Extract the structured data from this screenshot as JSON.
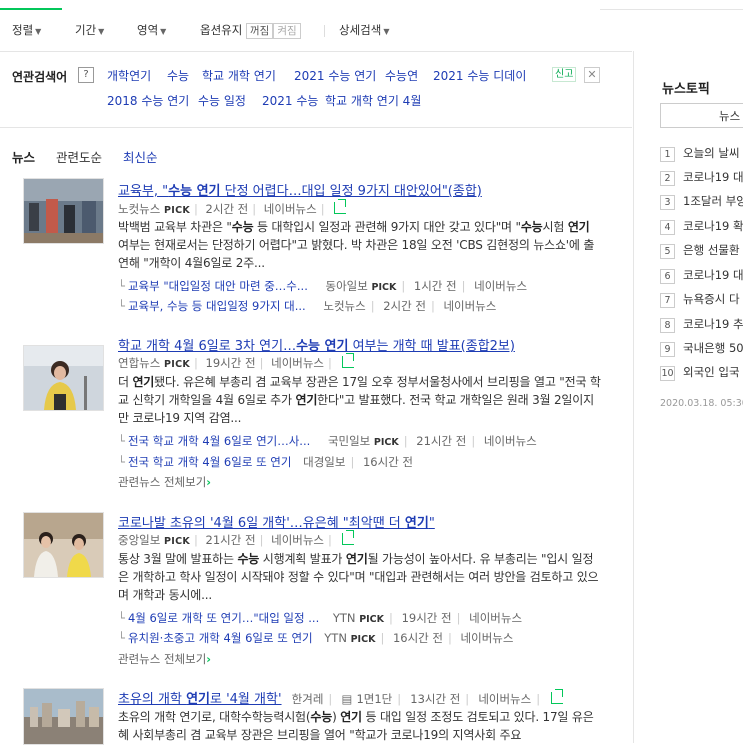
{
  "options": {
    "sort": "정렬",
    "period": "기간",
    "area": "영역",
    "option_keep": "옵션유지",
    "off": "꺼짐",
    "on": "켜짐",
    "detail_search": "상세검색"
  },
  "related": {
    "label": "연관검색어",
    "help": "?",
    "keywords": [
      "개학연기",
      "수능",
      "학교 개학 연기",
      "2021 수능 연기",
      "수능연",
      "2021 수능 디데이",
      "2018 수능 연기",
      "수능 일정",
      "2021 수능",
      "학교 개학 연기 4월"
    ],
    "report": "신고",
    "close": "✕"
  },
  "tabs": [
    "뉴스",
    "관련도순",
    "최신순"
  ],
  "articles": [
    {
      "title_pre": "교육부, \"",
      "title_bold": "수능 연기",
      "title_post": " 단정 어렵다…대입 일정 9가지 대안있어\"(종합)",
      "source": "노컷뉴스",
      "pick": "PICK",
      "time": "2시간 전",
      "portal": "네이버뉴스",
      "desc": [
        {
          "t": "박백범 교육부 차관은 \""
        },
        {
          "b": "수능"
        },
        {
          "t": " 등 대학입시 일정과 관련해 9가지 대안 갖고 있다\"며 \""
        },
        {
          "b": "수능"
        },
        {
          "t": "시험 "
        },
        {
          "b": "연기"
        },
        {
          "t": " 여부는 현재로서는 단정하기 어렵다\"고 밝혔다. 박 차관은 18일 오전 'CBS 김현정의 뉴스쇼'에 출연해 \"개학이 4월6일로 2주..."
        }
      ],
      "subs": [
        {
          "title": "교육부 \"대입일정 대안 마련 중…수...",
          "source": "동아일보",
          "pick": "PICK",
          "time": "1시간 전",
          "portal": "네이버뉴스"
        },
        {
          "title": "교육부, 수능 등 대입일정 9가지 대...",
          "source": "노컷뉴스",
          "pick": "",
          "time": "2시간 전",
          "portal": "네이버뉴스"
        }
      ]
    },
    {
      "title_pre": "학교 개학 4월 6일로 3차 연기…",
      "title_bold": "수능 연기",
      "title_post": " 여부는 개학 때 발표(종합2보)",
      "source": "연합뉴스",
      "pick": "PICK",
      "time": "19시간 전",
      "portal": "네이버뉴스",
      "desc": [
        {
          "t": "더 "
        },
        {
          "b": "연기"
        },
        {
          "t": "됐다. 유은혜 부총리 겸 교육부 장관은 17일 오후 정부서울청사에서 브리핑을 열고 \"전국 학교 신학기 개학일을 4월 6일로 추가 "
        },
        {
          "b": "연기"
        },
        {
          "t": "한다\"고 발표했다. 전국 학교 개학일은 원래 3월 2일이지만 코로나19 지역 감염..."
        }
      ],
      "subs": [
        {
          "title": "전국 학교 개학 4월 6일로 연기…사...",
          "source": "국민일보",
          "pick": "PICK",
          "time": "21시간 전",
          "portal": "네이버뉴스"
        },
        {
          "title": "전국 학교 개학 4월 6일로 또 연기",
          "source": "대경일보",
          "pick": "",
          "time": "16시간 전",
          "portal": ""
        }
      ],
      "more": "관련뉴스 전체보기"
    },
    {
      "title_pre": "코로나발 초유의 '4월 6일 개학'…유은혜 \"최악땐 더 ",
      "title_bold": "연기",
      "title_post": "\"",
      "source": "중앙일보",
      "pick": "PICK",
      "time": "21시간 전",
      "portal": "네이버뉴스",
      "desc": [
        {
          "t": "통상 3월 말에 발표하는 "
        },
        {
          "b": "수능"
        },
        {
          "t": " 시행계획 발표가 "
        },
        {
          "b": "연기"
        },
        {
          "t": "될 가능성이 높아서다. 유 부총리는 \"입시 일정은 개학하고 학사 일정이 시작돼야 정할 수 있다\"며 \"대입과 관련해서는 여러 방안을 검토하고 있으며 개학과 동시에..."
        }
      ],
      "subs": [
        {
          "title": "4월 6일로 개학 또 연기…\"대입 일정 ...",
          "source": "YTN",
          "pick": "PICK",
          "time": "19시간 전",
          "portal": "네이버뉴스"
        },
        {
          "title": "유치원·초중고 개학 4월 6일로 또 연기",
          "source": "YTN",
          "pick": "PICK",
          "time": "16시간 전",
          "portal": "네이버뉴스"
        }
      ],
      "more": "관련뉴스 전체보기"
    },
    {
      "title_pre": "초유의 개학 ",
      "title_bold": "연기",
      "title_post": "로 '4월 개학'",
      "source": "한겨레",
      "paper": "1면1단",
      "time": "13시간 전",
      "portal": "네이버뉴스",
      "desc": [
        {
          "t": "초유의 개학 연기로, 대학수학능력시험("
        },
        {
          "b": "수능"
        },
        {
          "t": ") "
        },
        {
          "b": "연기"
        },
        {
          "t": " 등 대입 일정 조정도 검토되고 있다. 17일 유은혜 사회부총리 겸 교육부 장관은 브리핑을 열어 \"학교가 코로나19의 지역사회 주요"
        }
      ]
    }
  ],
  "right": {
    "title": "뉴스토픽",
    "tab": "뉴스",
    "items": [
      {
        "n": "1",
        "t": "오늘의 날씨"
      },
      {
        "n": "2",
        "t": "코로나19 대"
      },
      {
        "n": "3",
        "t": "1조달러 부양"
      },
      {
        "n": "4",
        "t": "코로나19 확"
      },
      {
        "n": "5",
        "t": "은행 선물환"
      },
      {
        "n": "6",
        "t": "코로나19 대"
      },
      {
        "n": "7",
        "t": "뉴욕증시 다"
      },
      {
        "n": "8",
        "t": "코로나19 추"
      },
      {
        "n": "9",
        "t": "국내은행 50"
      },
      {
        "n": "10",
        "t": "외국인 입국"
      }
    ],
    "date": "2020.03.18. 05:30"
  }
}
